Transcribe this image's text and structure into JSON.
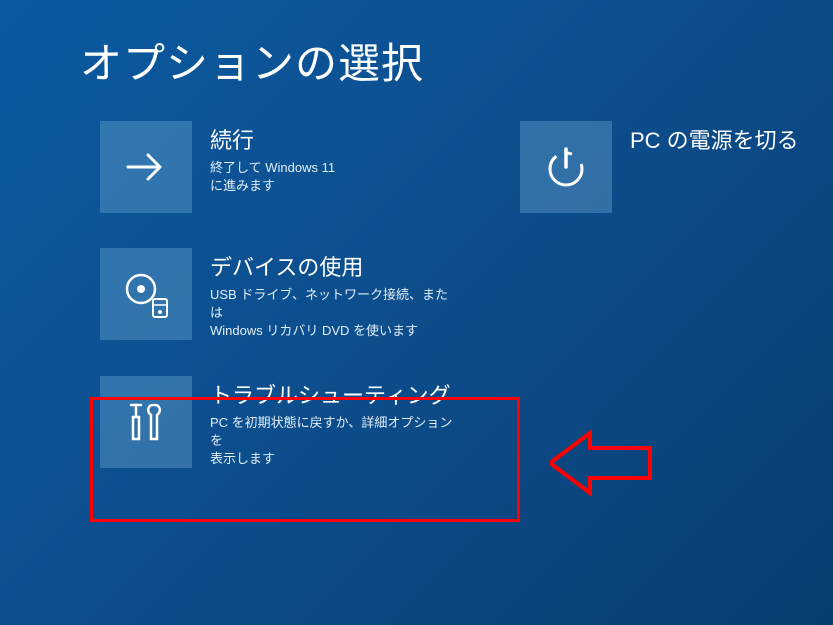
{
  "title": "オプションの選択",
  "options": {
    "continue": {
      "title": "続行",
      "desc": "終了して Windows 11\nに進みます"
    },
    "useDevice": {
      "title": "デバイスの使用",
      "desc": "USB ドライブ、ネットワーク接続、または\nWindows リカバリ DVD を使います"
    },
    "troubleshoot": {
      "title": "トラブルシューティング",
      "desc": "PC を初期状態に戻すか、詳細オプションを\n表示します"
    },
    "shutdown": {
      "title": "PC の電源を切る"
    }
  }
}
